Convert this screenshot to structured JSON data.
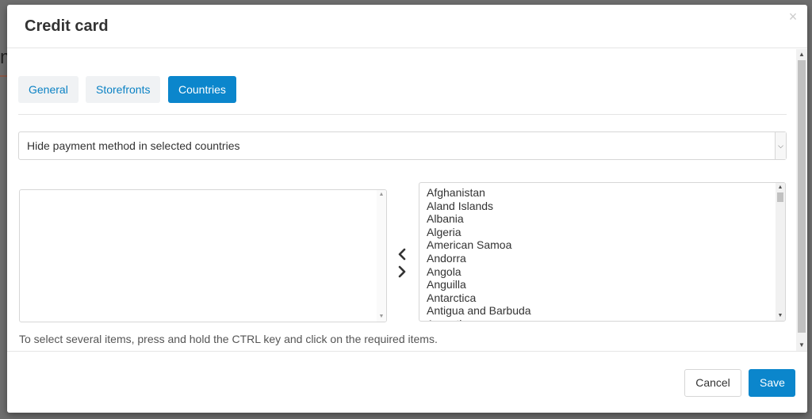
{
  "background": {
    "fragment_text": "m"
  },
  "modal": {
    "title": "Credit card",
    "close_glyph": "×"
  },
  "tabs": [
    {
      "label": "General",
      "active": false
    },
    {
      "label": "Storefronts",
      "active": false
    },
    {
      "label": "Countries",
      "active": true
    }
  ],
  "mode_select": {
    "selected": "Hide payment method in selected countries"
  },
  "selected_countries": [],
  "available_countries": [
    "Afghanistan",
    "Aland Islands",
    "Albania",
    "Algeria",
    "American Samoa",
    "Andorra",
    "Angola",
    "Anguilla",
    "Antarctica",
    "Antigua and Barbuda",
    "Argentina"
  ],
  "hint": "To select several items, press and hold the CTRL key and click on the required items.",
  "footer": {
    "cancel_label": "Cancel",
    "save_label": "Save"
  },
  "colors": {
    "accent": "#0b86cc",
    "tab_bg": "#f0f2f4",
    "overlay": "#6e6e6e"
  },
  "icons": {
    "move_left": "chevron-left-icon",
    "move_right": "chevron-right-icon",
    "close": "close-icon",
    "dropdown": "chevron-down-icon"
  }
}
